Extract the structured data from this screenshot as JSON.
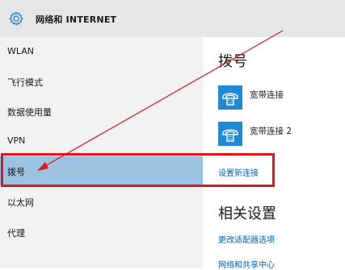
{
  "header": {
    "title": "网络和 INTERNET",
    "icon": "gear-icon",
    "background": "#e6e6e6"
  },
  "sidebar": {
    "items": [
      {
        "label": "WLAN",
        "selected": false
      },
      {
        "label": "飞行模式",
        "selected": false
      },
      {
        "label": "数据使用量",
        "selected": false
      },
      {
        "label": "VPN",
        "selected": false
      },
      {
        "label": "拨号",
        "selected": true
      },
      {
        "label": "以太网",
        "selected": false
      },
      {
        "label": "代理",
        "selected": false
      }
    ],
    "selected_color": "#9bc2e0"
  },
  "content": {
    "heading": "拨号",
    "connections": [
      {
        "label": "宽带连接",
        "icon": "dialup-phone-icon"
      },
      {
        "label": "宽带连接 2",
        "icon": "dialup-phone-icon"
      }
    ],
    "setup_link": "设置新连接",
    "related_heading": "相关设置",
    "related_links": [
      {
        "label": "更改适配器选项"
      },
      {
        "label": "网络和共享中心"
      }
    ],
    "link_color": "#0063b1",
    "tile_color": "#1f8ad6"
  },
  "annotation": {
    "box_color": "#e0151d",
    "arrow_color": "#e0151d"
  }
}
